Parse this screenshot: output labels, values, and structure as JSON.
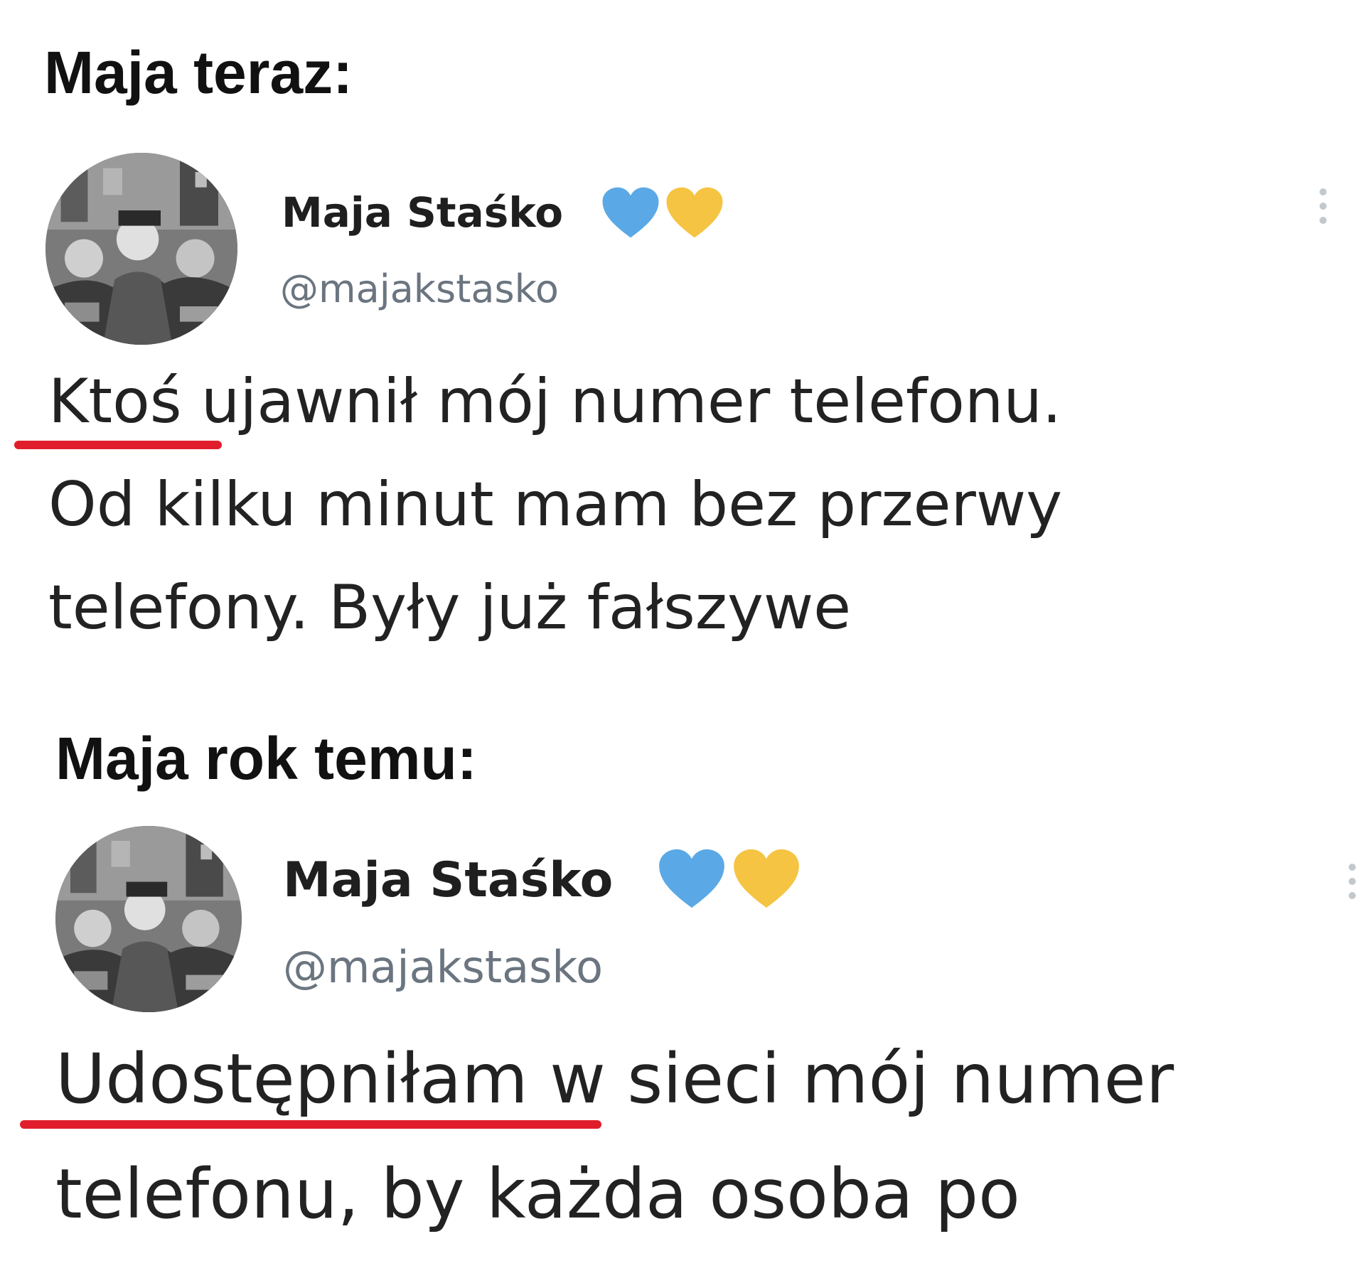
{
  "colors": {
    "blue_heart": "#5aa9e6",
    "yellow_heart": "#f5c443",
    "underline": "#e01e2b",
    "handle": "#6b7580"
  },
  "sections": [
    {
      "caption": "Maja teraz:",
      "tweet": {
        "display_name": "Maja Staśko",
        "handle": "@majakstasko",
        "icons": [
          "blue-heart-icon",
          "yellow-heart-icon",
          "more-options-icon"
        ],
        "lines": [
          {
            "highlight": "Ktoś",
            "rest": " ujawnił mój numer telefonu."
          },
          {
            "text": "Od kilku minut mam bez przerwy"
          },
          {
            "text": "telefony. Były już fałszywe"
          }
        ]
      }
    },
    {
      "caption": "Maja rok temu:",
      "tweet": {
        "display_name": "Maja Staśko",
        "handle": "@majakstasko",
        "icons": [
          "blue-heart-icon",
          "yellow-heart-icon",
          "more-options-icon"
        ],
        "lines": [
          {
            "highlight": "Udostępniłam",
            "rest": " w sieci mój numer"
          },
          {
            "text": "telefonu, by każda osoba po"
          }
        ]
      }
    }
  ]
}
